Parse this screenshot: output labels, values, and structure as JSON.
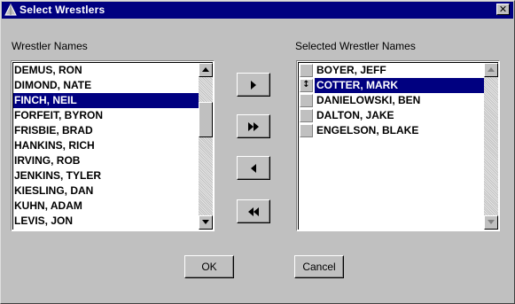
{
  "window": {
    "title": "Select Wrestlers",
    "close_glyph": "✕"
  },
  "left_panel": {
    "label": "Wrestler Names",
    "items": [
      "DEMUS, RON",
      "DIMOND, NATE",
      "FINCH, NEIL",
      "FORFEIT, BYRON",
      "FRISBIE, BRAD",
      "HANKINS, RICH",
      "IRVING, ROB",
      "JENKINS, TYLER",
      "KIESLING, DAN",
      "KUHN, ADAM",
      "LEVIS, JON"
    ],
    "selected_index": 2
  },
  "right_panel": {
    "label": "Selected Wrestler Names",
    "items": [
      "BOYER, JEFF",
      "COTTER, MARK",
      "DANIELOWSKI, BEN",
      "DALTON, JAKE",
      "ENGELSON, BLAKE"
    ],
    "selected_index": 1,
    "handle_glyph": "↕"
  },
  "transfer_buttons": [
    "add-one",
    "add-all",
    "remove-one",
    "remove-all"
  ],
  "buttons": {
    "ok": "OK",
    "cancel": "Cancel"
  },
  "colors": {
    "face": "#c0c0c0",
    "title_bar": "#000080",
    "selection": "#000080"
  }
}
